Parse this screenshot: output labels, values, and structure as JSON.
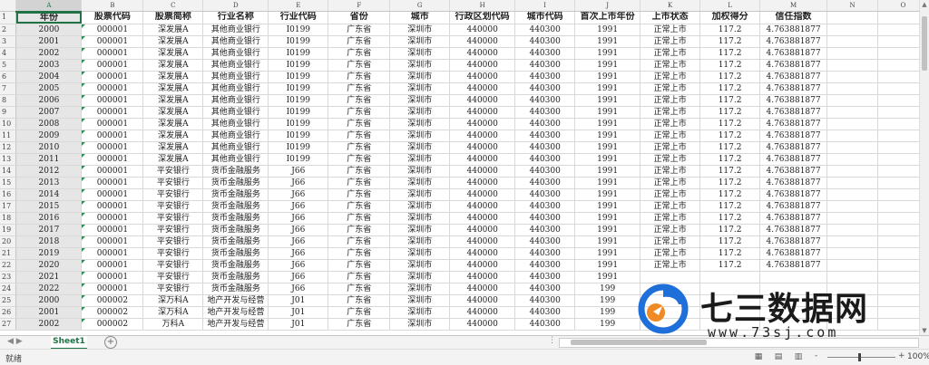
{
  "columns": [
    "A",
    "B",
    "C",
    "D",
    "E",
    "F",
    "G",
    "H",
    "I",
    "J",
    "K",
    "L",
    "M",
    "N",
    "O"
  ],
  "selected_column": "A",
  "header_row": [
    "年份",
    "股票代码",
    "股票简称",
    "行业名称",
    "行业代码",
    "省份",
    "城市",
    "行政区划代码",
    "城市代码",
    "首次上市年份",
    "上市状态",
    "加权得分",
    "信任指数",
    "",
    ""
  ],
  "rows": [
    [
      "2000",
      "000001",
      "深发展A",
      "其他商业银行",
      "I0199",
      "广东省",
      "深圳市",
      "440000",
      "440300",
      "1991",
      "正常上市",
      "117.2",
      "4.763881877"
    ],
    [
      "2001",
      "000001",
      "深发展A",
      "其他商业银行",
      "I0199",
      "广东省",
      "深圳市",
      "440000",
      "440300",
      "1991",
      "正常上市",
      "117.2",
      "4.763881877"
    ],
    [
      "2002",
      "000001",
      "深发展A",
      "其他商业银行",
      "I0199",
      "广东省",
      "深圳市",
      "440000",
      "440300",
      "1991",
      "正常上市",
      "117.2",
      "4.763881877"
    ],
    [
      "2003",
      "000001",
      "深发展A",
      "其他商业银行",
      "I0199",
      "广东省",
      "深圳市",
      "440000",
      "440300",
      "1991",
      "正常上市",
      "117.2",
      "4.763881877"
    ],
    [
      "2004",
      "000001",
      "深发展A",
      "其他商业银行",
      "I0199",
      "广东省",
      "深圳市",
      "440000",
      "440300",
      "1991",
      "正常上市",
      "117.2",
      "4.763881877"
    ],
    [
      "2005",
      "000001",
      "深发展A",
      "其他商业银行",
      "I0199",
      "广东省",
      "深圳市",
      "440000",
      "440300",
      "1991",
      "正常上市",
      "117.2",
      "4.763881877"
    ],
    [
      "2006",
      "000001",
      "深发展A",
      "其他商业银行",
      "I0199",
      "广东省",
      "深圳市",
      "440000",
      "440300",
      "1991",
      "正常上市",
      "117.2",
      "4.763881877"
    ],
    [
      "2007",
      "000001",
      "深发展A",
      "其他商业银行",
      "I0199",
      "广东省",
      "深圳市",
      "440000",
      "440300",
      "1991",
      "正常上市",
      "117.2",
      "4.763881877"
    ],
    [
      "2008",
      "000001",
      "深发展A",
      "其他商业银行",
      "I0199",
      "广东省",
      "深圳市",
      "440000",
      "440300",
      "1991",
      "正常上市",
      "117.2",
      "4.763881877"
    ],
    [
      "2009",
      "000001",
      "深发展A",
      "其他商业银行",
      "I0199",
      "广东省",
      "深圳市",
      "440000",
      "440300",
      "1991",
      "正常上市",
      "117.2",
      "4.763881877"
    ],
    [
      "2010",
      "000001",
      "深发展A",
      "其他商业银行",
      "I0199",
      "广东省",
      "深圳市",
      "440000",
      "440300",
      "1991",
      "正常上市",
      "117.2",
      "4.763881877"
    ],
    [
      "2011",
      "000001",
      "深发展A",
      "其他商业银行",
      "I0199",
      "广东省",
      "深圳市",
      "440000",
      "440300",
      "1991",
      "正常上市",
      "117.2",
      "4.763881877"
    ],
    [
      "2012",
      "000001",
      "平安银行",
      "货币金融服务",
      "J66",
      "广东省",
      "深圳市",
      "440000",
      "440300",
      "1991",
      "正常上市",
      "117.2",
      "4.763881877"
    ],
    [
      "2013",
      "000001",
      "平安银行",
      "货币金融服务",
      "J66",
      "广东省",
      "深圳市",
      "440000",
      "440300",
      "1991",
      "正常上市",
      "117.2",
      "4.763881877"
    ],
    [
      "2014",
      "000001",
      "平安银行",
      "货币金融服务",
      "J66",
      "广东省",
      "深圳市",
      "440000",
      "440300",
      "1991",
      "正常上市",
      "117.2",
      "4.763881877"
    ],
    [
      "2015",
      "000001",
      "平安银行",
      "货币金融服务",
      "J66",
      "广东省",
      "深圳市",
      "440000",
      "440300",
      "1991",
      "正常上市",
      "117.2",
      "4.763881877"
    ],
    [
      "2016",
      "000001",
      "平安银行",
      "货币金融服务",
      "J66",
      "广东省",
      "深圳市",
      "440000",
      "440300",
      "1991",
      "正常上市",
      "117.2",
      "4.763881877"
    ],
    [
      "2017",
      "000001",
      "平安银行",
      "货币金融服务",
      "J66",
      "广东省",
      "深圳市",
      "440000",
      "440300",
      "1991",
      "正常上市",
      "117.2",
      "4.763881877"
    ],
    [
      "2018",
      "000001",
      "平安银行",
      "货币金融服务",
      "J66",
      "广东省",
      "深圳市",
      "440000",
      "440300",
      "1991",
      "正常上市",
      "117.2",
      "4.763881877"
    ],
    [
      "2019",
      "000001",
      "平安银行",
      "货币金融服务",
      "J66",
      "广东省",
      "深圳市",
      "440000",
      "440300",
      "1991",
      "正常上市",
      "117.2",
      "4.763881877"
    ],
    [
      "2020",
      "000001",
      "平安银行",
      "货币金融服务",
      "J66",
      "广东省",
      "深圳市",
      "440000",
      "440300",
      "1991",
      "正常上市",
      "117.2",
      "4.763881877"
    ],
    [
      "2021",
      "000001",
      "平安银行",
      "货币金融服务",
      "J66",
      "广东省",
      "深圳市",
      "440000",
      "440300",
      "1991",
      "",
      "",
      ""
    ],
    [
      "2022",
      "000001",
      "平安银行",
      "货币金融服务",
      "J66",
      "广东省",
      "深圳市",
      "440000",
      "440300",
      "199",
      "",
      "",
      ""
    ],
    [
      "2000",
      "000002",
      "深万科A",
      "地产开发与经营",
      "J01",
      "广东省",
      "深圳市",
      "440000",
      "440300",
      "199",
      "",
      "",
      ""
    ],
    [
      "2001",
      "000002",
      "深万科A",
      "地产开发与经营",
      "J01",
      "广东省",
      "深圳市",
      "440000",
      "440300",
      "199",
      "",
      "",
      ""
    ],
    [
      "2002",
      "000002",
      "万科A",
      "地产开发与经营",
      "J01",
      "广东省",
      "深圳市",
      "440000",
      "440300",
      "199",
      "",
      "",
      ""
    ]
  ],
  "sheet_tab": "Sheet1",
  "add_sheet_icon": "plus-circle-icon",
  "status_text": "就绪",
  "zoom_minus": "-",
  "zoom_plus": "+",
  "zoom_level": "100%",
  "watermark": {
    "title": "七三数据网",
    "url": "www.73sj.com"
  },
  "colors": {
    "accent": "#217346",
    "header_bg": "#f2f2f2",
    "grid": "#d9d9d9",
    "logo_blue": "#1e6fd9",
    "logo_orange": "#f08a24"
  }
}
